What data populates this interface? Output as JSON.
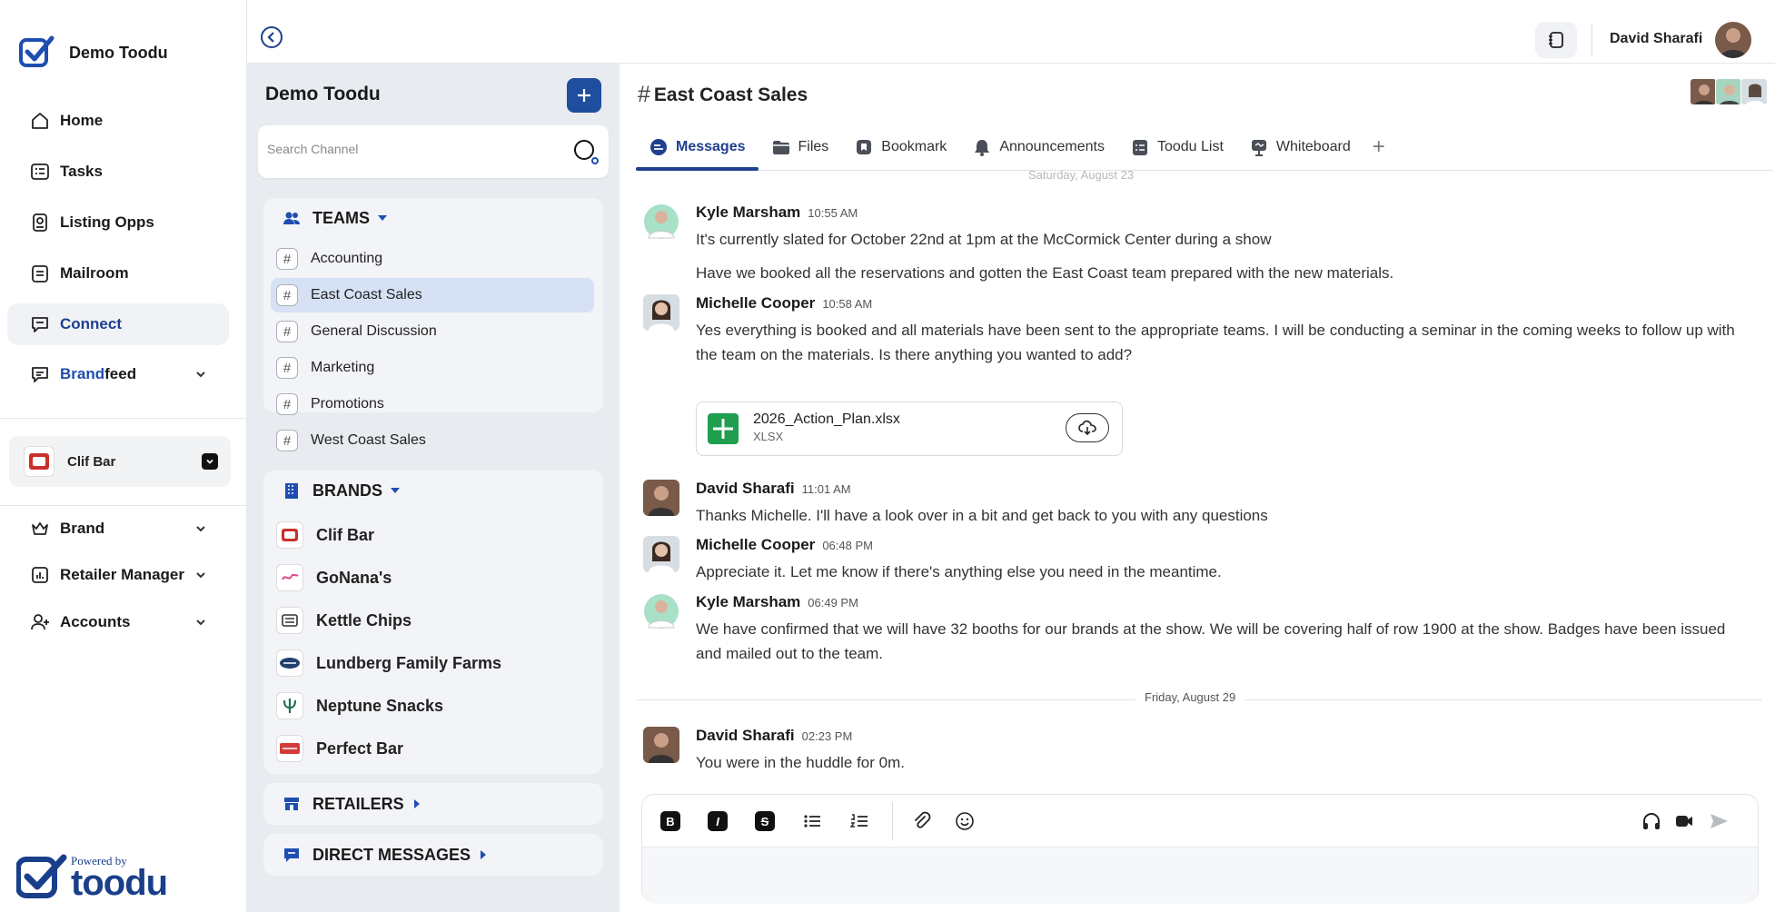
{
  "sidebar": {
    "brand_name": "Demo Toodu",
    "nav": [
      {
        "label": "Home",
        "icon": "home-icon"
      },
      {
        "label": "Tasks",
        "icon": "tasks-icon"
      },
      {
        "label": "Listing Opps",
        "icon": "listing-icon"
      },
      {
        "label": "Mailroom",
        "icon": "mailroom-icon"
      },
      {
        "label": "Connect",
        "icon": "chat-icon"
      }
    ],
    "brandfeed_a": "Brand",
    "brandfeed_b": "feed",
    "current_brand": "Clif Bar",
    "sections": [
      {
        "label": "Brand"
      },
      {
        "label": "Retailer Manager"
      },
      {
        "label": "Accounts"
      }
    ],
    "powered_by": "Powered by",
    "powered_word": "toodu"
  },
  "topbar": {
    "user_name": "David Sharafi"
  },
  "channels": {
    "title": "Demo Toodu",
    "search_placeholder": "Search Channel",
    "teams_label": "TEAMS",
    "teams": [
      "Accounting",
      "East Coast Sales",
      "General Discussion",
      "Marketing",
      "Promotions",
      "West Coast Sales"
    ],
    "active_team": "East Coast Sales",
    "brands_label": "BRANDS",
    "brands": [
      "Clif Bar",
      "GoNana's",
      "Kettle Chips",
      "Lundberg Family Farms",
      "Neptune Snacks",
      "Perfect Bar"
    ],
    "retailers_label": "RETAILERS",
    "dm_label": "DIRECT MESSAGES"
  },
  "chat": {
    "title": "East Coast Sales",
    "tabs": [
      "Messages",
      "Files",
      "Bookmark",
      "Announcements",
      "Toodu List",
      "Whiteboard"
    ],
    "tab_plus": "+",
    "date_top": "Saturday, August 23",
    "messages": [
      {
        "name": "Kyle Marsham",
        "time": "10:55 AM",
        "lines": [
          "It's currently slated for October 22nd at 1pm at the McCormick Center during a show",
          "Have we booked all the reservations and gotten the East Coast team prepared with the new materials."
        ]
      },
      {
        "name": "Michelle Cooper",
        "time": "10:58 AM",
        "text": "Yes everything is booked and all materials have been sent to the appropriate teams. I will be conducting a seminar in the coming weeks to follow up with the team on the materials. Is there anything you wanted to add?"
      },
      {
        "name": "David Sharafi",
        "time": "11:01 AM",
        "text": "Thanks Michelle. I'll have a look over in a bit and get back to you with any questions"
      },
      {
        "name": "Michelle Cooper",
        "time": "06:48 PM",
        "text": "Appreciate it. Let me know if there's anything else you need in the meantime."
      },
      {
        "name": "Kyle Marsham",
        "time": "06:49 PM",
        "text": "We have confirmed that we will have 32 booths for our brands at the show. We will be covering half of row 1900 at the show. Badges have been issued and mailed out to the team."
      },
      {
        "name": "David Sharafi",
        "time": "02:23 PM",
        "text": "You were in the huddle for 0m."
      }
    ],
    "file": {
      "name": "2026_Action_Plan.xlsx",
      "type": "XLSX"
    },
    "date_divider": "Friday, August 29",
    "composer": {
      "bold": "B",
      "italic": "I",
      "strike": "S"
    }
  }
}
